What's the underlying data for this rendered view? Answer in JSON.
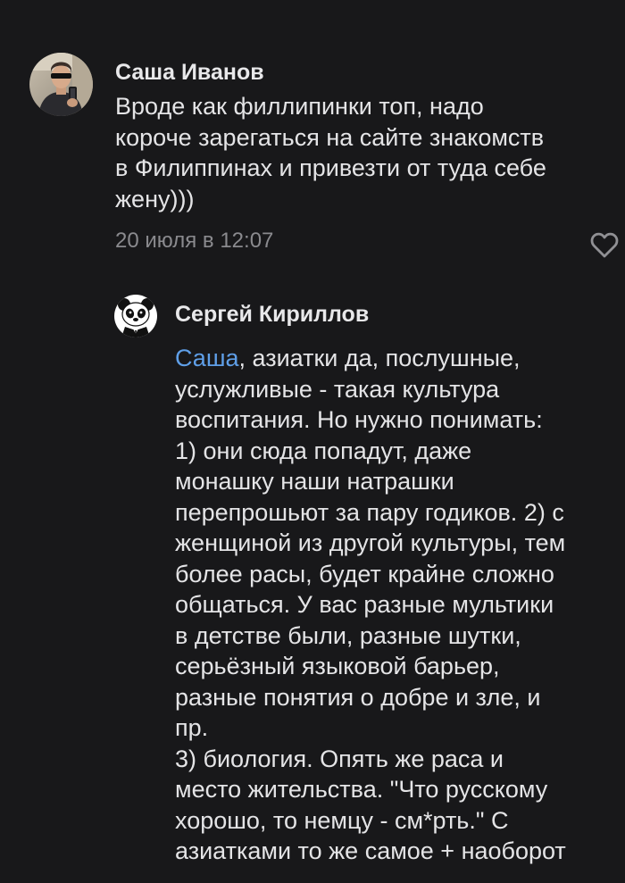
{
  "comments": [
    {
      "author": "Саша Иванов",
      "text": "Вроде как филлипинки топ, надо\nкороче зарегаться на сайте знакомств\nв Филиппинах и привезти от туда себе\nжену)))",
      "date": "20 июля в 12:07",
      "avatar_icon": "user-photo-avatar"
    },
    {
      "author": "Сергей Кириллов",
      "mention": "Саша",
      "text": ", азиатки да, послушные,\nуслужливые - такая культура\nвоспитания. Но нужно понимать:\n1) они сюда попадут, даже\nмонашку наши натрашки\nперепрошьют за пару годиков. 2) с\nженщиной из другой культуры, тем\nболее расы, будет крайне сложно\nобщаться. У вас разные мультики\nв детстве были, разные шутки,\nсерьёзный языковой барьер,\nразные понятия о добре и зле, и\nпр.\n3) биология. Опять же раса и\nместо жительства. \"Что русскому\nхорошо, то немцу - см*рть.\" С\nазиатками то же самое + наоборот",
      "avatar_icon": "panda-avatar"
    }
  ],
  "icons": {
    "like": "heart-outline-icon"
  },
  "colors": {
    "background": "#18181a",
    "text": "#e4e4e6",
    "meta": "#8a8a8e",
    "mention": "#5f9fe8"
  }
}
